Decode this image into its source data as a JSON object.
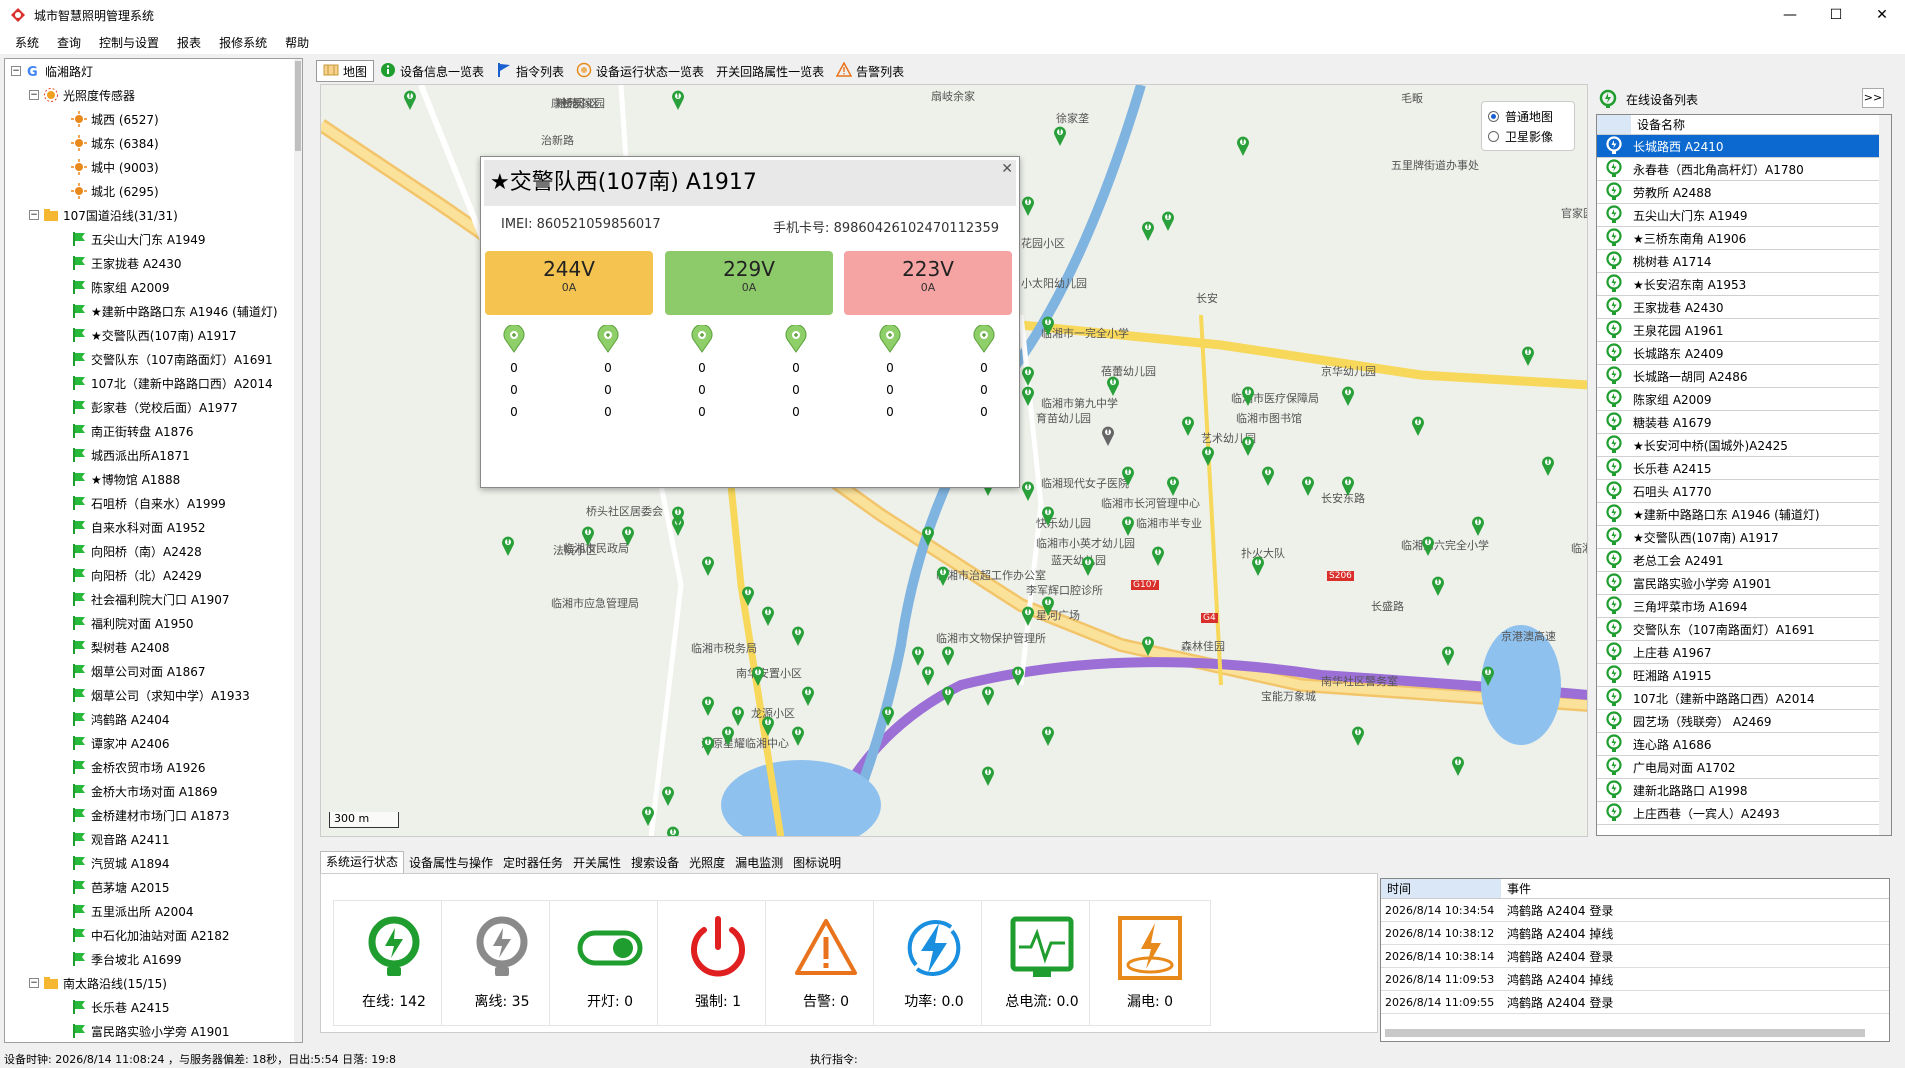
{
  "window": {
    "title": "城市智慧照明管理系统",
    "min": "—",
    "max": "☐",
    "close": "✕"
  },
  "menu": [
    "系统",
    "查询",
    "控制与设置",
    "报表",
    "报修系统",
    "帮助"
  ],
  "tree": {
    "root": "临湘路灯",
    "groups": [
      {
        "label": "光照度传感器",
        "items": [
          "城西 (6527)",
          "城东 (6384)",
          "城中 (9003)",
          "城北 (6295)"
        ]
      },
      {
        "label": "107国道沿线(31/31)",
        "items": [
          "五尖山大门东 A1949",
          "王家拢巷 A2430",
          "陈家组 A2009",
          "★建新中路路口东 A1946 (辅道灯)",
          "★交警队西(107南) A1917",
          "交警队东（107南路面灯）A1691",
          "107北（建新中路路口西）A2014",
          "彭家巷（党校后面）A1977",
          "南正街转盘 A1876",
          "城西派出所A1871",
          "★博物馆 A1888",
          "石咀桥（自来水）A1999",
          "自来水科对面 A1952",
          "向阳桥（南）A2428",
          "向阳桥（北）A2429",
          "社会福利院大门口 A1907",
          "福利院对面 A1950",
          "梨树巷 A2408",
          "烟草公司对面 A1867",
          "烟草公司（求知中学）A1933",
          "鸿鹤路 A2404",
          "谭家冲 A2406",
          "金桥农贸市场 A1926",
          "金桥大市场对面 A1869",
          "金桥建材市场门口 A1873",
          "观音路 A2411",
          "汽贸城 A1894",
          "芭茅塘 A2015",
          "五里派出所 A2004",
          "中石化加油站对面 A2182",
          "季台坡北 A1699"
        ]
      },
      {
        "label": "南太路沿线(15/15)",
        "items": [
          "长乐巷 A2415",
          "富民路实验小学旁 A1901"
        ]
      }
    ]
  },
  "map_tabs": [
    {
      "label": "地图",
      "icon": "map-icon"
    },
    {
      "label": "设备信息一览表",
      "icon": "info-icon"
    },
    {
      "label": "指令列表",
      "icon": "flag-icon"
    },
    {
      "label": "设备运行状态一览表",
      "icon": "status-icon"
    },
    {
      "label": "开关回路属性一览表",
      "icon": ""
    },
    {
      "label": "告警列表",
      "icon": "warning-icon"
    }
  ],
  "map": {
    "type_options": [
      "普通地图",
      "卫星影像"
    ],
    "scale": "300 m",
    "labels": [
      "扇岐余家",
      "徐家垄",
      "毛畈",
      "长安",
      "治新路",
      "五里牌街道办事处",
      "官家园",
      "花园小区",
      "小太阳幼儿园",
      "临湘市一完全小学",
      "蓓蕾幼儿园",
      "临湘市第九中学",
      "育苗幼儿园",
      "临湘市医疗保障局",
      "临湘市图书馆",
      "艺术幼儿园",
      "京华幼儿园",
      "长安东路",
      "临湘现代女子医院",
      "临湘市长河管理中心",
      "快乐幼儿园",
      "临湘市小英才幼儿园",
      "临湘市半专业",
      "蓝天幼儿园",
      "扑火大队",
      "桥头社区居委会",
      "法院小区",
      "临湘市民政局",
      "临湘市应急管理局",
      "临湘市治超工作办公室",
      "李军辉口腔诊所",
      "星河广场",
      "临湘市文物保护管理所",
      "临湘市税务局",
      "南华安置小区",
      "龙源小区",
      "江原星耀临湘中心",
      "南华社区警务室",
      "宝能万象城",
      "长盛路",
      "京港澳高速",
      "森林佳园",
      "临湘第六完全小学",
      "临湘临福医院",
      "康桥郡",
      "粮苑小区",
      "长乐家园"
    ],
    "roads": [
      "G107",
      "S206",
      "G4"
    ]
  },
  "popup": {
    "title": "★交警队西(107南) A1917",
    "imei_label": "IMEI:",
    "imei": "860521059856017",
    "phone_label": "手机卡号:",
    "phone": "89860426102470112359",
    "phases": [
      {
        "voltage": "244V",
        "current": "0A",
        "color": "#f5c34f"
      },
      {
        "voltage": "229V",
        "current": "0A",
        "color": "#8dcb6a"
      },
      {
        "voltage": "223V",
        "current": "0A",
        "color": "#f5a3a3"
      }
    ],
    "channels": [
      [
        "0",
        "0",
        "0"
      ],
      [
        "0",
        "0",
        "0"
      ],
      [
        "0",
        "0",
        "0"
      ],
      [
        "0",
        "0",
        "0"
      ],
      [
        "0",
        "0",
        "0"
      ],
      [
        "0",
        "0",
        "0"
      ]
    ]
  },
  "right_panel": {
    "title": "在线设备列表",
    "expand": ">>",
    "column": "设备名称",
    "devices": [
      "长城路西 A2410",
      "永春巷（西北角高杆灯）A1780",
      "劳教所 A2488",
      "五尖山大门东 A1949",
      "★三桥东南角 A1906",
      "桃树巷 A1714",
      "★长安沼东南 A1953",
      "王家拢巷 A2430",
      "王泉花园 A1961",
      "长城路东 A2409",
      "长城路一胡同 A2486",
      "陈家组 A2009",
      "糖装巷 A1679",
      "★长安河中桥(国城外)A2425",
      "长乐巷 A2415",
      "石咀头 A1770",
      "★建新中路路口东 A1946 (辅道灯)",
      "★交警队西(107南) A1917",
      "老总工会 A2491",
      "富民路实验小学旁 A1901",
      "三角坪菜市场 A1694",
      "交警队东（107南路面灯）A1691",
      "上庄巷 A1967",
      "旺湘路 A1915",
      "107北（建新中路路口西）A2014",
      "园艺场（残联旁） A2469",
      "连心路 A1686",
      "广电局对面 A1702",
      "建新北路路口 A1998",
      "上庄西巷（一宾人）A2493"
    ]
  },
  "bottom_tabs": [
    "系统运行状态",
    "设备属性与操作",
    "定时器任务",
    "开关属性",
    "搜索设备",
    "光照度",
    "漏电监测",
    "图标说明"
  ],
  "stats": [
    {
      "label": "在线:",
      "value": "142",
      "icon": "online-lamp-icon"
    },
    {
      "label": "离线:",
      "value": "35",
      "icon": "offline-lamp-icon"
    },
    {
      "label": "开灯:",
      "value": "0",
      "icon": "switch-on-icon"
    },
    {
      "label": "强制:",
      "value": "1",
      "icon": "power-icon"
    },
    {
      "label": "告警:",
      "value": "0",
      "icon": "alert-icon"
    },
    {
      "label": "功率:",
      "value": "0.0",
      "icon": "power-bolt-icon"
    },
    {
      "label": "总电流:",
      "value": "0.0",
      "icon": "current-monitor-icon"
    },
    {
      "label": "漏电:",
      "value": "0",
      "icon": "leakage-icon"
    }
  ],
  "events": {
    "col_time": "时间",
    "col_event": "事件",
    "rows": [
      {
        "time": "2026/8/14 10:34:54",
        "event": "鸿鹤路 A2404 登录"
      },
      {
        "time": "2026/8/14 10:38:12",
        "event": "鸿鹤路 A2404 掉线"
      },
      {
        "time": "2026/8/14 10:38:14",
        "event": "鸿鹤路 A2404 登录"
      },
      {
        "time": "2026/8/14 11:09:53",
        "event": "鸿鹤路 A2404 掉线"
      },
      {
        "time": "2026/8/14 11:09:55",
        "event": "鸿鹤路 A2404 登录"
      }
    ]
  },
  "statusbar": {
    "text": "设备时钟: 2026/8/14 11:08:24 ，与服务器偏差: 18秒，日出:5:54 日落: 19:8",
    "cmd": "执行指令:"
  },
  "colors": {
    "online": "#1f9d2e",
    "offline": "#888888",
    "alert": "#e8731c",
    "power": "#e02020",
    "bolt": "#1a8fe0",
    "selected": "#0b69cf"
  }
}
